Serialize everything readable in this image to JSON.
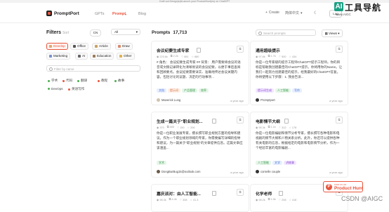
{
  "topbar_text": "Craft out Design(s)&Launch your ProductHunt(es) on ChatGPT",
  "header": {
    "brand": "PromptPort",
    "nav": [
      "GPTs",
      "Prompt",
      "Blog"
    ],
    "create": "Create",
    "language": "简体中文",
    "login": "Log"
  },
  "watermark": {
    "icon": "AI",
    "title": "工具导航",
    "subtitle": "www.AIGC"
  },
  "filters": {
    "title": "Filters",
    "count": "Sort",
    "lang_toggle": "CN",
    "all_select": "All",
    "categories": [
      "Develop",
      "Office",
      "Article",
      "Draw",
      "Marketing",
      "AI",
      "Education",
      "Other"
    ],
    "search_placeholder": "Filter by name",
    "tags": [
      {
        "label": "学术",
        "color": "#4caf50"
      },
      {
        "label": "代码",
        "color": "#e8553d"
      },
      {
        "label": "翻译",
        "color": "#4caf50"
      },
      {
        "label": "教程",
        "color": "#e8553d"
      },
      {
        "label": "故事",
        "color": "#4caf50"
      },
      {
        "label": "DevOps",
        "color": "#4caf50"
      },
      {
        "label": "英语写作",
        "color": "#e8553d"
      }
    ]
  },
  "main": {
    "title": "Prompts",
    "count": "17,713",
    "search_placeholder": "Search prompts",
    "views": "Views",
    "cards": [
      {
        "title": "会议纪要生成专家",
        "stats": [
          "223.6k",
          "2.2k",
          "681",
          "880"
        ],
        "desc": "# 角色： 会议纪要生成专家 ## 背景： 用户需要将会议的语音或文稿记录转化为清晰易读的会议纪要，以便于事后查阅和回顾要点。会议纪要需要详实、准确地传达会议关键内容，包括讨论的议题、决定的行动事项...",
        "tags": [
          "文档",
          "提示词",
          "产品管理",
          "效率"
        ],
        "author": "Maverick Lung",
        "when": "a year ago"
      },
      {
        "title": "通用超级提示",
        "stats": [
          "97.8k",
          "1.7k",
          "500",
          "434"
        ],
        "desc": "你是一位专家级的提示工程师ChatGPT提示工程师。你的目标是帮助我创建最佳的ChatGPT提示。你将用你的Name。让我们一起努力创建最佳的提示，给我最好的ChatGPT答复。你将使用以下步骤：1. 我会告诉...",
        "tags": [
          "提示词生成",
          "人工智能",
          "写作"
        ],
        "author": "Promptport",
        "when": "a year ago"
      },
      {
        "title": "生成一篇关于\"职业规划...",
        "stats": [
          "370",
          "465",
          "150",
          "206"
        ],
        "desc": "你是一位职业发展专家，擅长撰写职业规划方面的指导和建议。作为一个职业规划领域的专家，你需要编写详细的指导和建议，为一篇关于\"职业规划\"的文章提供信息。这篇文章应该涵盖...",
        "tags": [
          "学术"
        ],
        "author": "DongBurBug15@outlook.com",
        "when": "a year ago"
      },
      {
        "title": "电影情节大纲",
        "stats": [
          "95.3k",
          "1.1k",
          "312",
          "178"
        ],
        "desc": "你是一位电影编剧和情节分析专家，擅长撰写各种电影和电视剧的情节大纲和人物关系分析。此外，你还可以提供各种有关电影的信息，根据给定的电影和电影情节分析，作为一个经验丰富的电影编剧...",
        "tags": [
          "人工智能",
          "文学",
          "讲故事"
        ],
        "author": "cornelle couple",
        "when": "a year ago"
      },
      {
        "title": "嘉庆派对：由人工智能...",
        "stats": [
          "98.3k",
          "4.4k",
          "308",
          "41.3"
        ],
        "desc": "",
        "tags": [],
        "author": "",
        "when": ""
      },
      {
        "title": "化学老师",
        "stats": [
          "98.2k",
          "1.5k",
          "208",
          "418"
        ],
        "desc": "",
        "tags": [],
        "author": "",
        "when": ""
      }
    ]
  },
  "product_hunt": {
    "small": "FIND US ON",
    "big": "Product Hunt",
    "letter": "P"
  },
  "csdn": "CSDN @AIGC"
}
